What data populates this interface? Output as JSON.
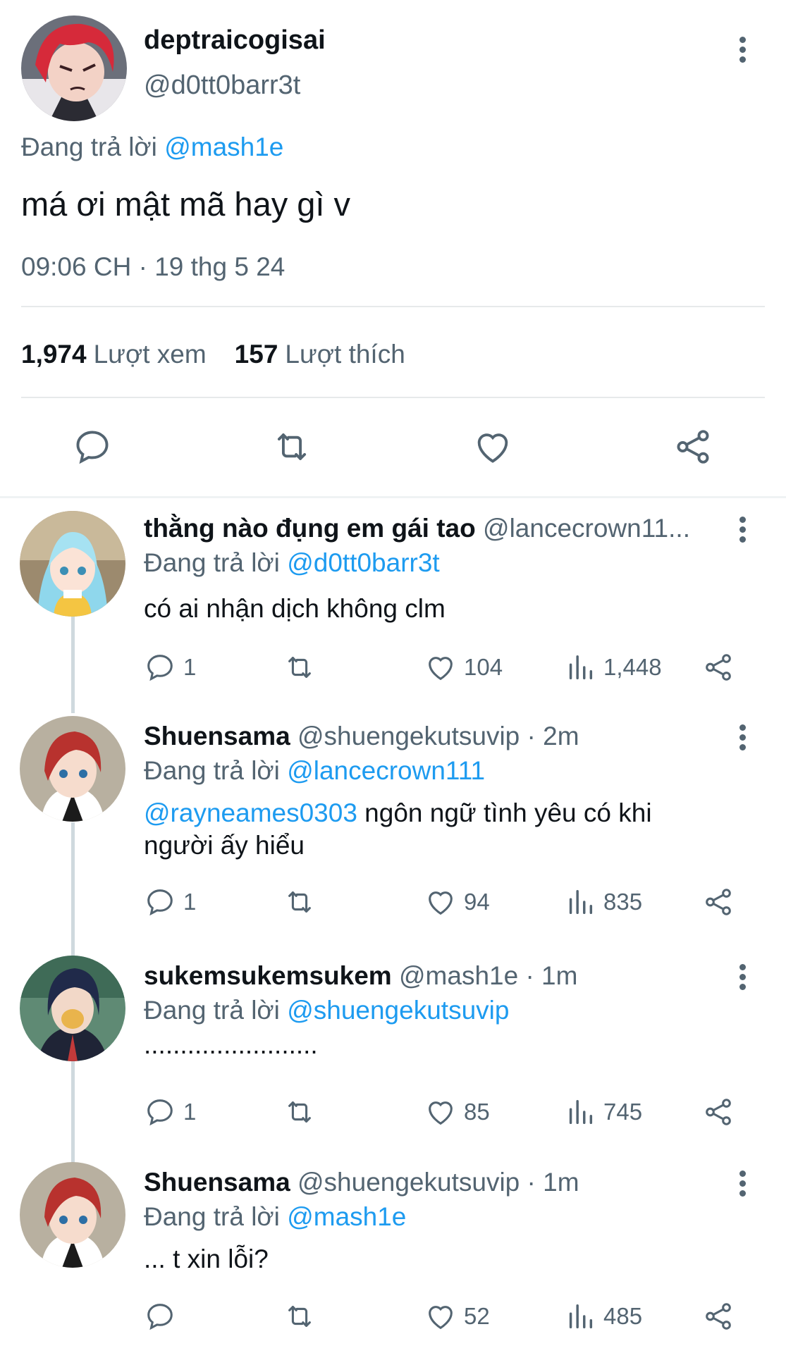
{
  "main_tweet": {
    "display_name": "deptraicogisai",
    "handle": "@d0tt0barr3t",
    "replying_prefix": "Đang trả lời",
    "replying_to": "@mash1e",
    "text": "má ơi mật mã hay gì v",
    "timestamp": "09:06 CH · 19 thg 5 24",
    "views_count": "1,974",
    "views_label": "Lượt xem",
    "likes_count": "157",
    "likes_label": "Lượt thích"
  },
  "replies": [
    {
      "display_name": "thằng nào đụng em gái tao",
      "handle": "@lancecrown11...",
      "replying_prefix": "Đang trả lời",
      "replying_to": "@d0tt0barr3t",
      "mention": "",
      "text": "có ai nhận dịch không clm",
      "reply_count": "1",
      "like_count": "104",
      "view_count": "1,448"
    },
    {
      "display_name": "Shuensama",
      "handle": "@shuengekutsuvip · 2m",
      "replying_prefix": "Đang trả lời",
      "replying_to": "@lancecrown111",
      "mention": "@rayneames0303",
      "text": " ngôn ngữ tình yêu có khi người ấy hiểu",
      "reply_count": "1",
      "like_count": "94",
      "view_count": "835"
    },
    {
      "display_name": "sukemsukemsukem",
      "handle": "@mash1e · 1m",
      "replying_prefix": "Đang trả lời",
      "replying_to": "@shuengekutsuvip",
      "mention": "",
      "text": "........................",
      "reply_count": "1",
      "like_count": "85",
      "view_count": "745"
    },
    {
      "display_name": "Shuensama",
      "handle": "@shuengekutsuvip · 1m",
      "replying_prefix": "Đang trả lời",
      "replying_to": "@mash1e",
      "mention": "",
      "text": "... t xin lỗi?",
      "reply_count": "",
      "like_count": "52",
      "view_count": "485"
    }
  ],
  "icons": {
    "reply": "reply-icon",
    "retweet": "retweet-icon",
    "like": "heart-icon",
    "views": "views-icon",
    "share": "share-icon",
    "more": "more-vertical-icon"
  },
  "colors": {
    "link": "#1d9bf0",
    "secondary_text": "#536471",
    "primary_text": "#0f1419",
    "divider": "#e7e9ea"
  }
}
